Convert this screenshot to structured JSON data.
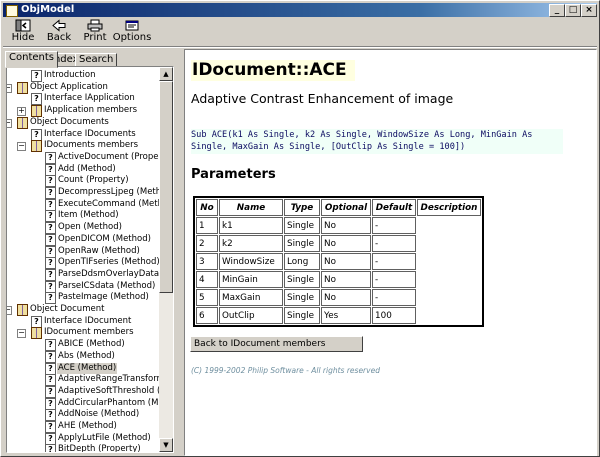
{
  "window": {
    "title": "ObjModel"
  },
  "toolbar": {
    "hide": "Hide",
    "back": "Back",
    "print": "Print",
    "options": "Options"
  },
  "tabs": [
    "Contents",
    "Index",
    "Search"
  ],
  "tree": [
    {
      "label": "Introduction",
      "level": 1,
      "icon": "help"
    },
    {
      "label": "Object Application",
      "level": 0,
      "icon": "book",
      "expander": "−"
    },
    {
      "label": "Interface IApplication",
      "level": 2,
      "icon": "help"
    },
    {
      "label": "IApplication members",
      "level": 1,
      "icon": "book",
      "expander": "+"
    },
    {
      "label": "Object Documents",
      "level": 0,
      "icon": "book",
      "expander": "−"
    },
    {
      "label": "Interface IDocuments",
      "level": 2,
      "icon": "help"
    },
    {
      "label": "IDocuments members",
      "level": 1,
      "icon": "book",
      "expander": "−"
    },
    {
      "label": "ActiveDocument (Property)",
      "level": 3,
      "icon": "help"
    },
    {
      "label": "Add (Method)",
      "level": 3,
      "icon": "help"
    },
    {
      "label": "Count (Property)",
      "level": 3,
      "icon": "help"
    },
    {
      "label": "DecompressLjpeg (Method)",
      "level": 3,
      "icon": "help"
    },
    {
      "label": "ExecuteCommand (Method)",
      "level": 3,
      "icon": "help"
    },
    {
      "label": "Item (Method)",
      "level": 3,
      "icon": "help"
    },
    {
      "label": "Open (Method)",
      "level": 3,
      "icon": "help"
    },
    {
      "label": "OpenDICOM (Method)",
      "level": 3,
      "icon": "help"
    },
    {
      "label": "OpenRaw (Method)",
      "level": 3,
      "icon": "help"
    },
    {
      "label": "OpenTIFseries (Method)",
      "level": 3,
      "icon": "help"
    },
    {
      "label": "ParseDdsmOverlayData (M",
      "level": 3,
      "icon": "help"
    },
    {
      "label": "ParseICSdata (Method)",
      "level": 3,
      "icon": "help"
    },
    {
      "label": "PasteImage (Method)",
      "level": 3,
      "icon": "help"
    },
    {
      "label": "Object Document",
      "level": 0,
      "icon": "book",
      "expander": "−"
    },
    {
      "label": "Interface IDocument",
      "level": 2,
      "icon": "help"
    },
    {
      "label": "IDocument members",
      "level": 1,
      "icon": "book",
      "expander": "−"
    },
    {
      "label": "ABICE (Method)",
      "level": 3,
      "icon": "help"
    },
    {
      "label": "Abs (Method)",
      "level": 3,
      "icon": "help"
    },
    {
      "label": "ACE (Method)",
      "level": 3,
      "icon": "help",
      "selected": true
    },
    {
      "label": "AdaptiveRangeTransforma",
      "level": 3,
      "icon": "help"
    },
    {
      "label": "AdaptiveSoftThreshold (Me",
      "level": 3,
      "icon": "help"
    },
    {
      "label": "AddCircularPhantom (Meth",
      "level": 3,
      "icon": "help"
    },
    {
      "label": "AddNoise (Method)",
      "level": 3,
      "icon": "help"
    },
    {
      "label": "AHE (Method)",
      "level": 3,
      "icon": "help"
    },
    {
      "label": "ApplyLutFile (Method)",
      "level": 3,
      "icon": "help"
    },
    {
      "label": "BitDepth (Property)",
      "level": 3,
      "icon": "help"
    }
  ],
  "page": {
    "heading": "IDocument::ACE",
    "subtitle": "Adaptive Contrast Enhancement of image",
    "code_line1": "Sub ACE(k1 As Single, k2 As Single, WindowSize As Long, MinGain As",
    "code_line2": "Single, MaxGain As Single, [OutClip As Single = 100])",
    "params_heading": "Parameters",
    "columns": [
      "No",
      "Name",
      "Type",
      "Optional",
      "Default",
      "Description"
    ],
    "rows": [
      [
        "1",
        "k1",
        "Single",
        "No",
        "-",
        ""
      ],
      [
        "2",
        "k2",
        "Single",
        "No",
        "-",
        ""
      ],
      [
        "3",
        "WindowSize",
        "Long",
        "No",
        "-",
        ""
      ],
      [
        "4",
        "MinGain",
        "Single",
        "No",
        "-",
        ""
      ],
      [
        "5",
        "MaxGain",
        "Single",
        "No",
        "-",
        ""
      ],
      [
        "6",
        "OutClip",
        "Single",
        "Yes",
        "100",
        ""
      ]
    ],
    "back_link": "Back to IDocument members",
    "copyright": "(C) 1999-2002 Philip Software - All rights reserved"
  }
}
